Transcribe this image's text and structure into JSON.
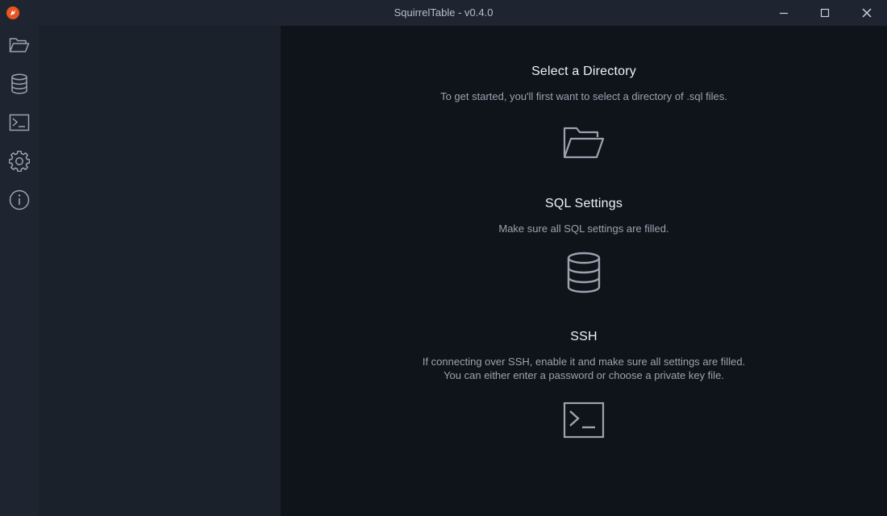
{
  "window": {
    "title": "SquirrelTable - v0.4.0"
  },
  "iconbar": {
    "items": [
      {
        "id": "folder",
        "icon": "folder-open-icon"
      },
      {
        "id": "database",
        "icon": "database-icon"
      },
      {
        "id": "terminal",
        "icon": "terminal-icon"
      },
      {
        "id": "settings",
        "icon": "gear-icon"
      },
      {
        "id": "about",
        "icon": "info-icon"
      }
    ]
  },
  "main": {
    "sections": [
      {
        "title": "Select a Directory",
        "description": "To get started, you'll first want to select a directory of .sql files.",
        "icon": "folder-open-icon"
      },
      {
        "title": "SQL Settings",
        "description": "Make sure all SQL settings are filled.",
        "icon": "database-icon"
      },
      {
        "title": "SSH",
        "description_lines": [
          "If connecting over SSH, enable it and make sure all settings are filled.",
          "You can either enter a password or choose a private key file."
        ],
        "icon": "terminal-icon"
      }
    ]
  },
  "colors": {
    "titlebar_bg": "#1e2530",
    "sidepanel_bg": "#1a212b",
    "main_bg": "#0f131a",
    "icon_stroke": "#9aa4b0",
    "logo_accent": "#e8561f"
  }
}
